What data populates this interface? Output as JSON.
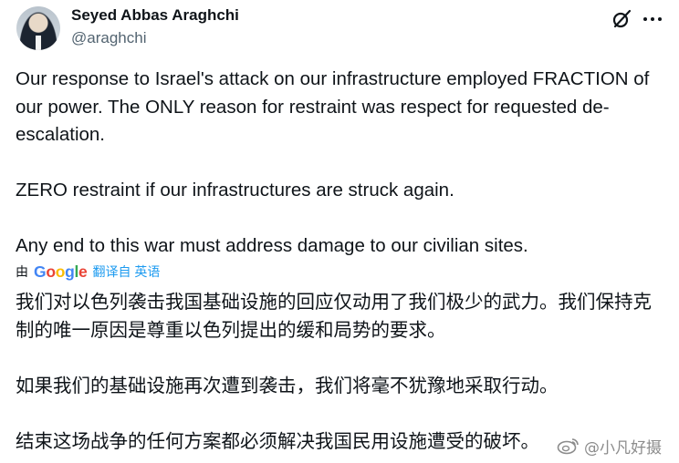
{
  "author": {
    "name": "Seyed Abbas Araghchi",
    "handle": "@araghchi"
  },
  "icons": {
    "grok": "grok-slash-icon",
    "more": "more-dots-icon"
  },
  "tweet": {
    "paragraphs": [
      "Our response to Israel's attack on our infrastructure employed FRACTION of our power. The ONLY reason for restraint was respect for requested de-escalation.",
      "ZERO restraint if our infrastructures are struck again.",
      "Any end to this war must address damage to our civilian sites."
    ]
  },
  "translation": {
    "by": "由",
    "provider": "Google",
    "translated_from": "翻译自 英语",
    "paragraphs": [
      "我们对以色列袭击我国基础设施的回应仅动用了我们极少的武力。我们保持克制的唯一原因是尊重以色列提出的缓和局势的要求。",
      "如果我们的基础设施再次遭到袭击，我们将毫不犹豫地采取行动。",
      "结束这场战争的任何方案都必须解决我国民用设施遭受的破坏。"
    ]
  },
  "watermark": {
    "text": "@小凡好摄"
  },
  "colors": {
    "link": "#1d9bf0",
    "text": "#0f1419",
    "secondary": "#536471"
  }
}
